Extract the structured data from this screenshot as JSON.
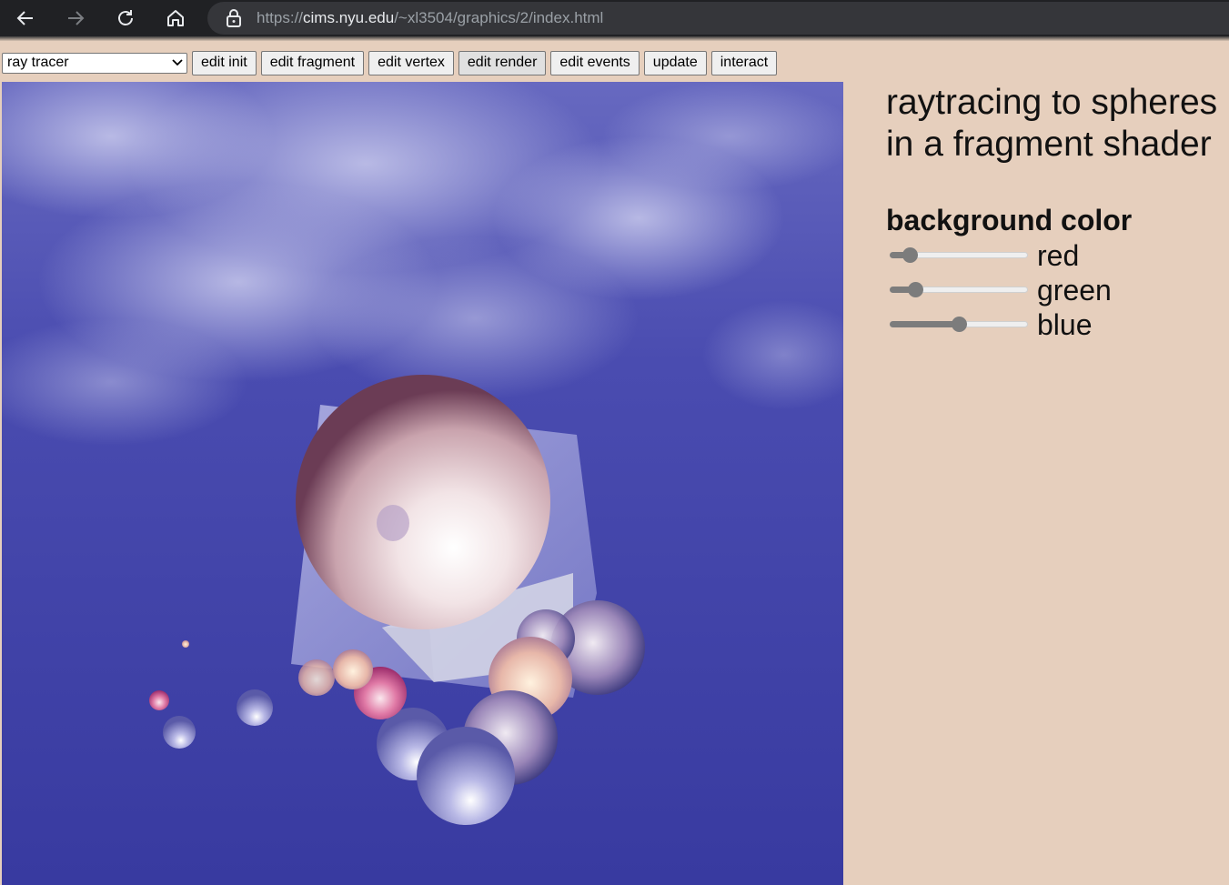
{
  "browser": {
    "url_scheme": "https://",
    "url_host": "cims.nyu.edu",
    "url_path": "/~xl3504/graphics/2/index.html"
  },
  "toolbar": {
    "demo_select_value": "ray tracer",
    "buttons": [
      "edit init",
      "edit fragment",
      "edit vertex",
      "edit render",
      "edit events",
      "update",
      "interact"
    ],
    "active_button": "edit render"
  },
  "panel": {
    "title_line1": "raytracing to spheres",
    "title_line2": "in a fragment shader",
    "heading": "background color",
    "sliders": [
      {
        "label": "red",
        "value": 0.1
      },
      {
        "label": "green",
        "value": 0.15
      },
      {
        "label": "blue",
        "value": 0.5
      }
    ]
  },
  "colors": {
    "page_background": "#e6cfbd",
    "sky": "#3d3fa6",
    "slider_fill": "#7c7c7c"
  },
  "icons": [
    "back-arrow-icon",
    "forward-arrow-icon",
    "reload-icon",
    "home-icon",
    "lock-icon",
    "chevron-down-icon"
  ]
}
